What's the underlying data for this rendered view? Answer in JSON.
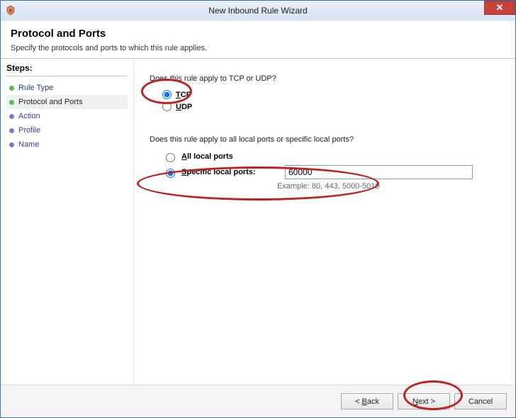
{
  "window": {
    "title": "New Inbound Rule Wizard"
  },
  "header": {
    "title": "Protocol and Ports",
    "subtitle": "Specify the protocols and ports to which this rule applies."
  },
  "sidebar": {
    "heading": "Steps:",
    "items": [
      {
        "label": "Rule Type",
        "status": "done",
        "bullet": "done"
      },
      {
        "label": "Protocol and Ports",
        "status": "current",
        "bullet": "done"
      },
      {
        "label": "Action",
        "status": "todo",
        "bullet": "todo"
      },
      {
        "label": "Profile",
        "status": "todo",
        "bullet": "todo"
      },
      {
        "label": "Name",
        "status": "todo",
        "bullet": "todo"
      }
    ]
  },
  "content": {
    "question_protocol": "Does this rule apply to TCP or UDP?",
    "radio_tcp": "TCP",
    "radio_udp": "UDP",
    "protocol_selected": "tcp",
    "question_ports": "Does this rule apply to all local ports or specific local ports?",
    "radio_all": "All local ports",
    "radio_specific": "Specific local ports:",
    "ports_selected": "specific",
    "port_value": "60000",
    "example_label": "Example: 80, 443, 5000-5010"
  },
  "footer": {
    "back": "< Back",
    "next": "Next >",
    "cancel": "Cancel"
  }
}
